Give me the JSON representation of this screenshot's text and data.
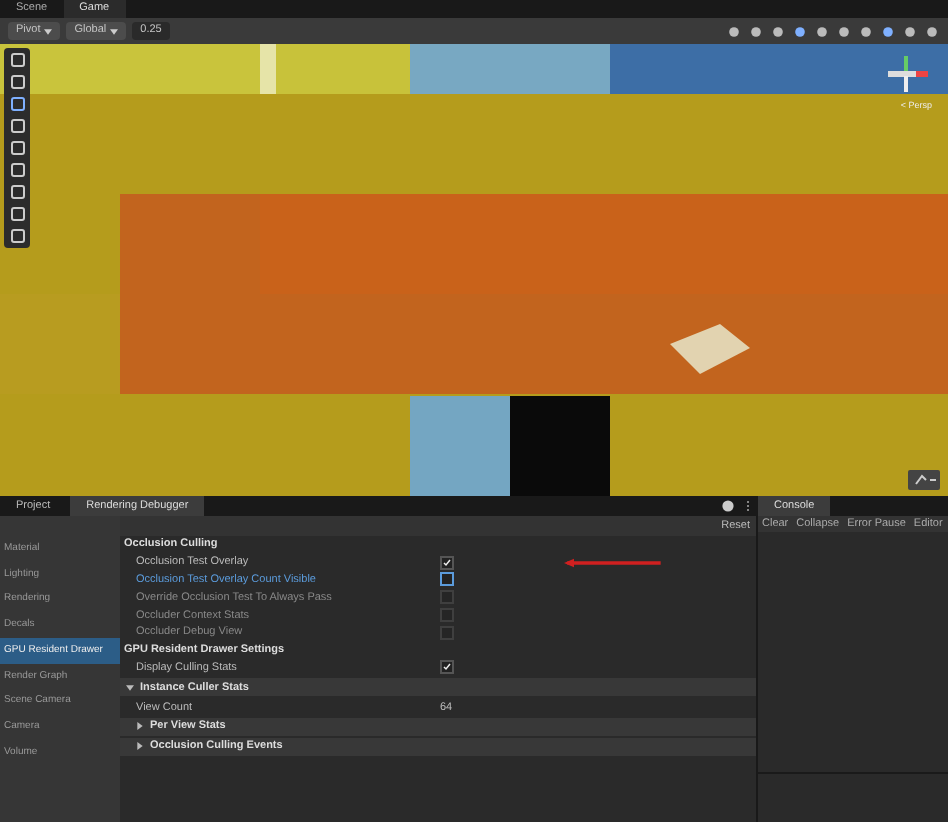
{
  "view_tabs": [
    {
      "label": "Scene",
      "selected": false
    },
    {
      "label": "Game",
      "selected": true
    }
  ],
  "toolbar": {
    "pivot": "Pivot",
    "space": "Global",
    "snap": "0.25"
  },
  "gizmo": {
    "label": "< Persp"
  },
  "panel_tabs": [
    {
      "label": "Project",
      "selected": false
    },
    {
      "label": "Rendering Debugger",
      "selected": true
    }
  ],
  "reset": "Reset",
  "sidebar": [
    {
      "label": "Material",
      "selected": false
    },
    {
      "label": "Lighting",
      "selected": false
    },
    {
      "label": "Rendering",
      "selected": false
    },
    {
      "label": "Decals",
      "selected": false
    },
    {
      "label": "GPU Resident Drawer",
      "selected": true
    },
    {
      "label": "Render Graph",
      "selected": false
    },
    {
      "label": "Scene Camera",
      "selected": false
    },
    {
      "label": "Camera",
      "selected": false
    },
    {
      "label": "Volume",
      "selected": false
    }
  ],
  "rows": [
    {
      "kind": "header",
      "label": "Occlusion Culling"
    },
    {
      "kind": "toggle",
      "label": "Occlusion Test Overlay",
      "checked": true,
      "selected": false,
      "disabled": false
    },
    {
      "kind": "toggle",
      "label": "Occlusion Test Overlay Count Visible",
      "checked": false,
      "selected": true,
      "disabled": false
    },
    {
      "kind": "toggle",
      "label": "Override Occlusion Test To Always Pass",
      "checked": false,
      "selected": false,
      "disabled": true
    },
    {
      "kind": "toggle",
      "label": "Occluder Context Stats",
      "checked": false,
      "selected": false,
      "disabled": true
    },
    {
      "kind": "toggle",
      "label": "Occluder Debug View",
      "checked": false,
      "selected": false,
      "disabled": true
    },
    {
      "kind": "header",
      "label": "GPU Resident Drawer Settings"
    },
    {
      "kind": "toggle",
      "label": "Display Culling Stats",
      "checked": true,
      "selected": false,
      "disabled": false
    },
    {
      "kind": "foldout",
      "label": "Instance Culler Stats",
      "expanded": true,
      "nested": false
    },
    {
      "kind": "value",
      "label": "View Count",
      "value": "64"
    },
    {
      "kind": "foldout",
      "label": "Per View Stats",
      "expanded": false,
      "nested": true
    },
    {
      "kind": "foldout",
      "label": "Occlusion Culling Events",
      "expanded": false,
      "nested": true
    }
  ],
  "console": {
    "title": "Console",
    "buttons": [
      "Clear",
      "Collapse",
      "Error Pause",
      "Editor"
    ]
  }
}
